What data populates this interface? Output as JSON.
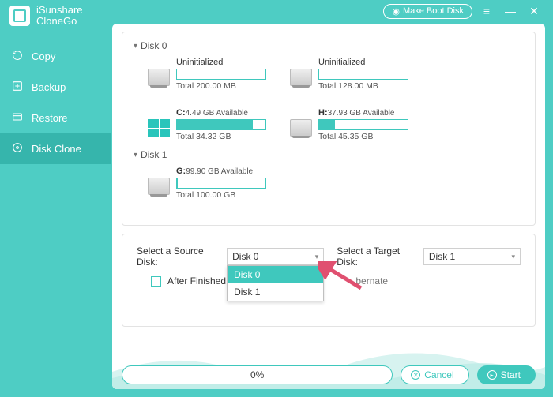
{
  "brand": {
    "line1": "iSunshare",
    "line2": "CloneGo"
  },
  "titlebar": {
    "make_boot": "Make Boot Disk"
  },
  "nav": {
    "copy": "Copy",
    "backup": "Backup",
    "restore": "Restore",
    "diskclone": "Disk Clone"
  },
  "disks": {
    "d0": {
      "label": "Disk 0"
    },
    "d1": {
      "label": "Disk 1"
    },
    "v0": {
      "label": "Uninitialized",
      "total": "Total 200.00 MB",
      "fill": 0
    },
    "v1": {
      "label": "Uninitialized",
      "total": "Total 128.00 MB",
      "fill": 0
    },
    "v2": {
      "letter": "C:",
      "avail": "4.49 GB Available",
      "total": "Total 34.32 GB",
      "fill": 86
    },
    "v3": {
      "letter": "H:",
      "avail": "37.93 GB Available",
      "total": "Total 45.35 GB",
      "fill": 18
    },
    "v4": {
      "letter": "G:",
      "avail": "99.90 GB Available",
      "total": "Total 100.00 GB",
      "fill": 1
    }
  },
  "controls": {
    "source_label": "Select a Source Disk:",
    "target_label": "Select a Target Disk:",
    "source_value": "Disk 0",
    "target_value": "Disk 1",
    "dd_opt0": "Disk 0",
    "dd_opt1": "Disk 1",
    "after_label": "After Finished:",
    "hibernate": "bernate"
  },
  "footer": {
    "progress": "0%",
    "cancel": "Cancel",
    "start": "Start"
  }
}
